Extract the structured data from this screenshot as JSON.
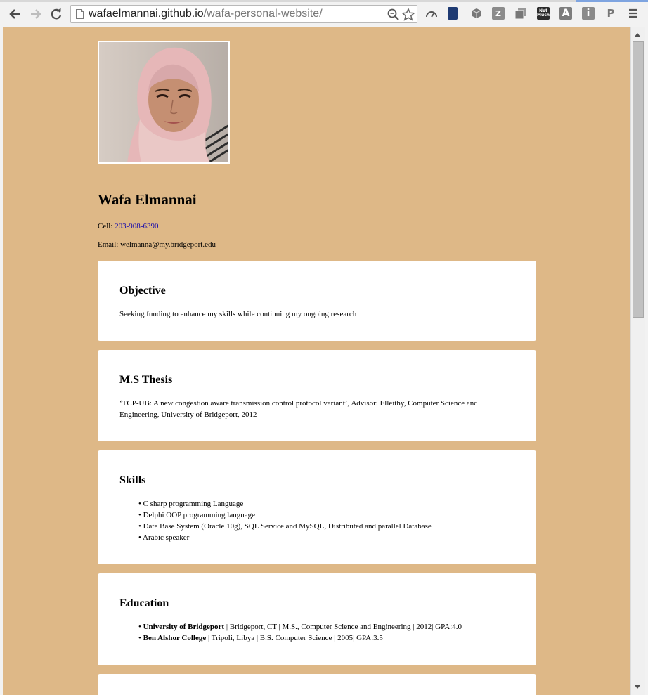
{
  "browser": {
    "url_host": "wafaelmannai.github.io",
    "url_path": "/wafa-personal-website/",
    "extension_letters": {
      "zotero": "Z",
      "notmuch": "Not Much",
      "readability": "A",
      "info": "i",
      "pocket": "P"
    }
  },
  "profile": {
    "name": "Wafa Elmannai",
    "cell_label": "Cell:",
    "cell_number": "203-908-6390",
    "email_label": "Email:",
    "email": "welmanna@my.bridgeport.edu"
  },
  "sections": {
    "objective": {
      "title": "Objective",
      "text": "Seeking funding to enhance my skills while continuing my ongoing research"
    },
    "thesis": {
      "title": "M.S Thesis",
      "text": "‘TCP-UB: A new congestion aware transmission control protocol variant’, Advisor: Elleithy, Computer Science and Engineering, University of Bridgeport, 2012"
    },
    "skills": {
      "title": "Skills",
      "items": [
        "C sharp programming Language",
        "Delphi OOP programming language",
        "Date Base System (Oracle 10g), SQL Service and MySQL, Distributed and parallel Database",
        "Arabic speaker"
      ]
    },
    "education": {
      "title": "Education",
      "items": [
        {
          "school": "University of Bridgeport",
          "details": " | Bridgeport, CT | M.S., Computer Science and Engineering | 2012| GPA:4.0"
        },
        {
          "school": "Ben Alshor College",
          "details": " | Tripoli, Libya | B.S. Computer Science | 2005| GPA:3.5"
        }
      ]
    }
  },
  "colors": {
    "page_background": "#deb887",
    "card_background": "#ffffff",
    "link": "#1a0dab"
  }
}
